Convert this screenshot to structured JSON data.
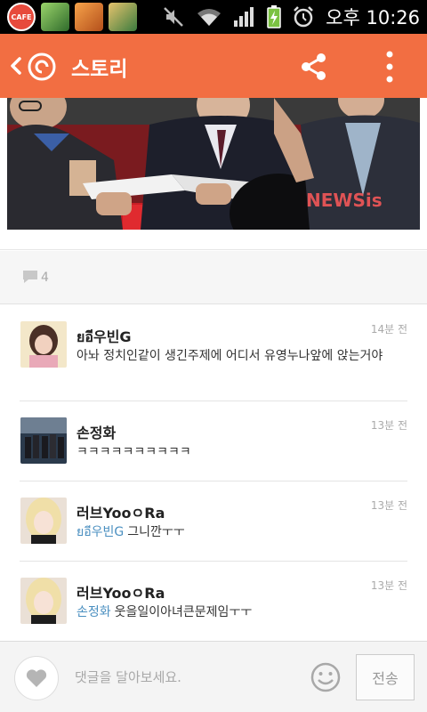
{
  "status_bar": {
    "cafe_label": "CAFE",
    "time": "오후 10:26",
    "icons": [
      "mute-icon",
      "wifi-icon",
      "signal-icon",
      "battery-charging-icon",
      "alarm-icon"
    ]
  },
  "app_bar": {
    "title": "스토리",
    "background": "#f26e42",
    "icons": [
      "back-icon",
      "story-logo-icon",
      "share-icon",
      "more-vert-icon"
    ]
  },
  "photo": {
    "watermark": "NEWSis"
  },
  "comment_count": "4",
  "comments": [
    {
      "author": "ยอี우빈G",
      "time": "14분 전",
      "mention": "",
      "text": "아놔 정치인같이 생긴주제에 어디서 유영누나앞에 앉는거야"
    },
    {
      "author": "손정화",
      "time": "13분 전",
      "mention": "",
      "text": "ㅋㅋㅋㅋㅋㅋㅋㅋㅋㅋ"
    },
    {
      "author": "러브YooㅇRa",
      "time": "13분 전",
      "mention": "ยอี우빈G",
      "text": "그니깐ㅜㅜ"
    },
    {
      "author": "러브YooㅇRa",
      "time": "13분 전",
      "mention": "손정화",
      "text": "웃을일이아녀큰문제임ㅜㅜ"
    }
  ],
  "input_bar": {
    "placeholder": "댓글을 달아보세요.",
    "send_label": "전송"
  }
}
